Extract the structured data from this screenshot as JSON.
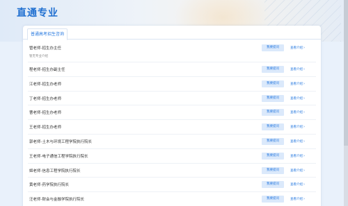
{
  "header": {
    "title": "直通专业"
  },
  "tabs": [
    {
      "label": "普通高考招生咨询"
    }
  ],
  "actions": {
    "ask_label": "我要提问",
    "view_label": "查看介绍"
  },
  "teachers": [
    {
      "name": "管老师-招生办主任",
      "sub": "管无专业介绍"
    },
    {
      "name": "程老师-招生办副主任"
    },
    {
      "name": "江老师-招生办老师"
    },
    {
      "name": "丁老师-招生办老师"
    },
    {
      "name": "曹老师-招生办老师"
    },
    {
      "name": "王老师-招生办老师"
    },
    {
      "name": "郭老师-土木与环境工程学院执行院长"
    },
    {
      "name": "王老师-电子通信工程学院执行院长"
    },
    {
      "name": "姬老师-信息工程学院执行院长"
    },
    {
      "name": "黄老师-药学院执行院长"
    },
    {
      "name": "汪老师-财会与金融学院执行院长"
    }
  ],
  "colors": {
    "accent": "#2a7be0",
    "title": "#1f6fd0",
    "button_bg": "#dbe9fb"
  }
}
